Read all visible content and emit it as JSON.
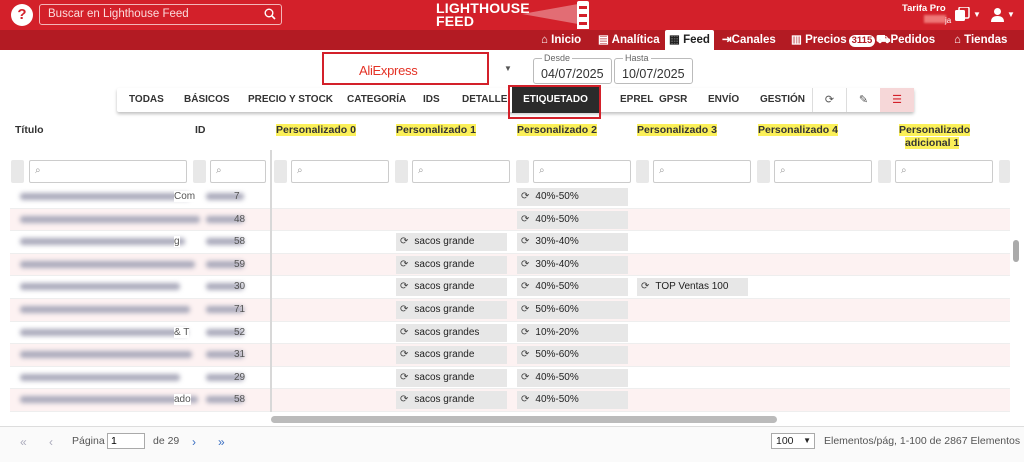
{
  "header": {
    "help": "?",
    "search_placeholder": "Buscar en Lighthouse Feed",
    "logo_line1": "LIGHTHOUSE",
    "logo_line2": "FEED",
    "plan": "Tarifa Pro",
    "account_suffix": "ja"
  },
  "nav": [
    {
      "label": "Inicio",
      "icon": "home-icon"
    },
    {
      "label": "Analítica",
      "icon": "chart-icon"
    },
    {
      "label": "Feed",
      "icon": "table-icon",
      "active": true
    },
    {
      "label": "Canales",
      "icon": "export-icon"
    },
    {
      "label": "Precios",
      "icon": "price-chart-icon",
      "badge": "3115"
    },
    {
      "label": "Pedidos",
      "icon": "truck-icon"
    },
    {
      "label": "Tiendas",
      "icon": "store-icon"
    }
  ],
  "shop": {
    "name": "AliExpress"
  },
  "dates": {
    "from_label": "Desde",
    "from": "04/07/2025",
    "to_label": "Hasta",
    "to": "10/07/2025"
  },
  "tabs": [
    "TODAS",
    "BÁSICOS",
    "PRECIO Y STOCK",
    "CATEGORÍA",
    "IDS",
    "DETALLE",
    "ETIQUETADO",
    "EPREL",
    "GPSR",
    "ENVÍO",
    "GESTIÓN"
  ],
  "active_tab": "ETIQUETADO",
  "columns": {
    "titulo": "Título",
    "id": "ID",
    "p0": "Personalizado 0",
    "p1": "Personalizado 1",
    "p2": "Personalizado 2",
    "p3": "Personalizado 3",
    "p4": "Personalizado 4",
    "pa1_line1": "Personalizado",
    "pa1_line2": "adicional 1"
  },
  "rows": [
    {
      "title_tail": "Com",
      "id_tail": "7",
      "p1": "",
      "p2": "40%-50%",
      "p3": ""
    },
    {
      "title_tail": "",
      "id_tail": "48",
      "p1": "",
      "p2": "40%-50%",
      "p3": ""
    },
    {
      "title_tail": "g",
      "id_tail": "58",
      "p1": "sacos grande",
      "p2": "30%-40%",
      "p3": ""
    },
    {
      "title_tail": "",
      "id_tail": "59",
      "p1": "sacos grande",
      "p2": "30%-40%",
      "p3": ""
    },
    {
      "title_tail": "",
      "id_tail": "30",
      "p1": "sacos grande",
      "p2": "40%-50%",
      "p3": "TOP Ventas 100"
    },
    {
      "title_tail": "",
      "id_tail": "71",
      "p1": "sacos grande",
      "p2": "50%-60%",
      "p3": ""
    },
    {
      "title_tail": "& T",
      "id_tail": "52",
      "p1": "sacos grandes",
      "p2": "10%-20%",
      "p3": ""
    },
    {
      "title_tail": "",
      "id_tail": "31",
      "p1": "sacos grande",
      "p2": "50%-60%",
      "p3": ""
    },
    {
      "title_tail": "",
      "id_tail": "29",
      "p1": "sacos grande",
      "p2": "40%-50%",
      "p3": ""
    },
    {
      "title_tail": "ado",
      "id_tail": "58",
      "p1": "sacos grande",
      "p2": "40%-50%",
      "p3": ""
    }
  ],
  "footer": {
    "page_label": "Página",
    "page_value": "1",
    "of_label": "de 29",
    "per_page": "100",
    "summary": "Elementos/pág, 1-100 de 2867 Elementos"
  }
}
